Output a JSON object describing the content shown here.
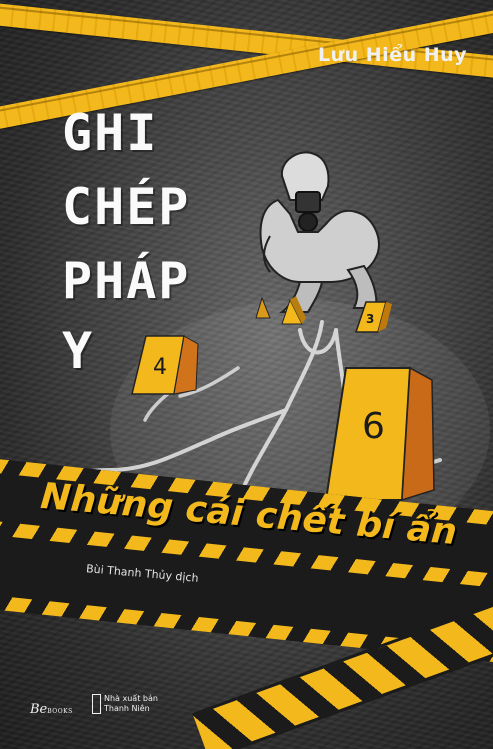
{
  "cover": {
    "author": "Lưu Hiểu Huy",
    "title_lines": [
      "GHI",
      "CHÉP",
      "PHÁP",
      "Y"
    ],
    "subtitle_parts": [
      "Những",
      "cái",
      "chết",
      "bí ẩn"
    ],
    "translator": "Bùi Thanh Thủy dịch",
    "evidence_markers": [
      "4",
      "3",
      "6"
    ],
    "publisher_logo": "Be",
    "publisher_logo_small": "BOOKS",
    "publisher_line1": "Nhà xuất bản",
    "publisher_line2": "Thanh Niên"
  },
  "colors": {
    "tape_yellow": "#f2b81c",
    "background_dark": "#2c2c2c",
    "title_white": "#fafafa"
  }
}
